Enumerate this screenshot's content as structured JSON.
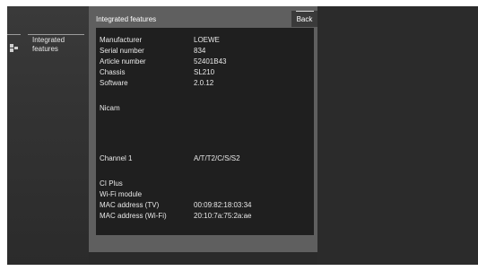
{
  "sidebar": {
    "item": {
      "label_line1": "Integrated",
      "label_line2": "features",
      "icon": "list-icon"
    }
  },
  "panel": {
    "title": "Integrated features",
    "back_label": "Back"
  },
  "info": {
    "rows": [
      {
        "key": "Manufacturer",
        "value": "LOEWE"
      },
      {
        "key": "Serial number",
        "value": "834"
      },
      {
        "key": "Article number",
        "value": "52401B43"
      },
      {
        "key": "Chassis",
        "value": "SL210"
      },
      {
        "key": "Software",
        "value": "2.0.12"
      },
      {
        "key": "Nicam",
        "value": ""
      },
      {
        "key": "Channel 1",
        "value": "A/T/T2/C/S/S2"
      },
      {
        "key": "CI Plus",
        "value": ""
      },
      {
        "key": "Wi-Fi module",
        "value": ""
      },
      {
        "key": "MAC address (TV)",
        "value": "00:09:82:18:03:34"
      },
      {
        "key": "MAC address (Wi-Fi)",
        "value": "20:10:7a:75:2a:ae"
      }
    ]
  },
  "colors": {
    "background": "#2a2a2a",
    "panel": "#5f5f5f",
    "content": "#1f1f1f",
    "text": "#e8e8e8"
  }
}
